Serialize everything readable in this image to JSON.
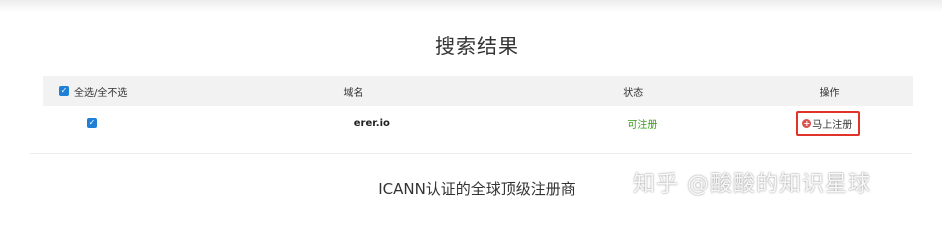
{
  "section_title": "搜索结果",
  "table": {
    "headers": {
      "select_all": "全选/全不选",
      "domain": "域名",
      "status": "状态",
      "action": "操作"
    },
    "rows": [
      {
        "checked": true,
        "domain": "erer.io",
        "status": "可注册",
        "action": "马上注册"
      }
    ]
  },
  "footer": {
    "registrar_text": "ICANN认证的全球顶级注册商"
  },
  "watermark": "知乎 @酸酸的知识星球",
  "colors": {
    "checkbox": "#1e7fd6",
    "status_available": "#3a9a1a",
    "highlight_border": "#e2332b"
  }
}
